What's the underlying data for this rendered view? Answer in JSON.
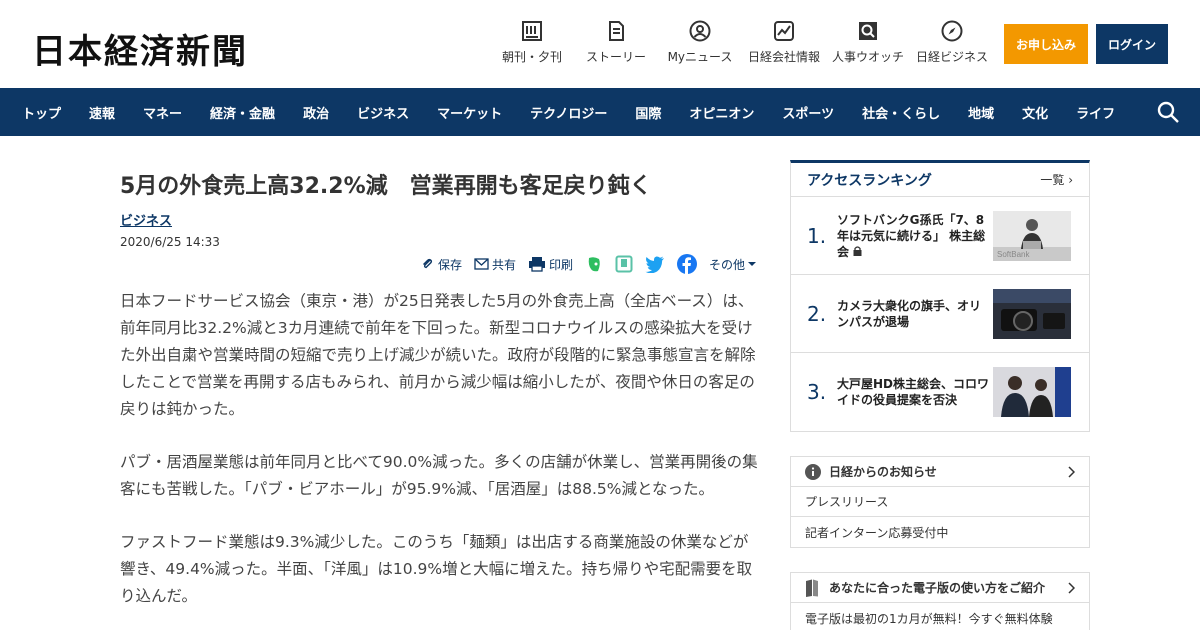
{
  "header": {
    "logo": "日本経済新聞",
    "nav": [
      {
        "label": "朝刊・夕刊",
        "icon": "newspaper-icon"
      },
      {
        "label": "ストーリー",
        "icon": "document-icon"
      },
      {
        "label": "Myニュース",
        "icon": "user-icon"
      },
      {
        "label": "日経会社情報",
        "icon": "chart-icon"
      },
      {
        "label": "人事ウオッチ",
        "icon": "search-person-icon"
      },
      {
        "label": "日経ビジネス",
        "icon": "compass-icon"
      }
    ],
    "apply_label": "お申し込み",
    "login_label": "ログイン",
    "apply_color": "#f39800",
    "brand_color": "#0d3765"
  },
  "mainnav": {
    "items": [
      "トップ",
      "速報",
      "マネー",
      "経済・金融",
      "政治",
      "ビジネス",
      "マーケット",
      "テクノロジー",
      "国際",
      "オピニオン",
      "スポーツ",
      "社会・くらし",
      "地域",
      "文化",
      "ライフ"
    ]
  },
  "article": {
    "headline": "5月の外食売上高32.2%減　営業再開も客足戻り鈍く",
    "category": "ビジネス",
    "date": "2020/6/25 14:33",
    "tools": {
      "save": "保存",
      "share": "共有",
      "print": "印刷",
      "more": "その他"
    },
    "paragraphs": [
      "日本フードサービス協会（東京・港）が25日発表した5月の外食売上高（全店ベース）は、前年同月比32.2%減と3カ月連続で前年を下回った。新型コロナウイルスの感染拡大を受けた外出自粛や営業時間の短縮で売り上げ減少が続いた。政府が段階的に緊急事態宣言を解除したことで営業を再開する店もみられ、前月から減少幅は縮小したが、夜間や休日の客足の戻りは鈍かった。",
      "パブ・居酒屋業態は前年同月と比べて90.0%減った。多くの店舗が休業し、営業再開後の集客にも苦戦した。「パブ・ビアホール」が95.9%減、「居酒屋」は88.5%減となった。",
      "ファストフード業態は9.3%減少した。このうち「麺類」は出店する商業施設の休業などが響き、49.4%減った。半面、「洋風」は10.9%増と大幅に増えた。持ち帰りや宅配需要を取り込んだ。"
    ]
  },
  "ranking": {
    "title": "アクセスランキング",
    "more": "一覧",
    "items": [
      {
        "num": "1.",
        "text": "ソフトバンクG孫氏「7、8年は元気に続ける」 株主総会"
      },
      {
        "num": "2.",
        "text": "カメラ大衆化の旗手、オリンパスが退場"
      },
      {
        "num": "3.",
        "text": "大戸屋HD株主総会、コロワイドの役員提案を否決"
      }
    ],
    "thumb_label_1": "SoftBank"
  },
  "notice": {
    "title": "日経からのお知らせ",
    "rows": [
      "プレスリリース",
      "記者インターン応募受付中"
    ]
  },
  "guide": {
    "title": "あなたに合った電子版の使い方をご紹介",
    "rows": [
      "電子版は最初の1カ月が無料！今すぐ無料体験"
    ]
  }
}
